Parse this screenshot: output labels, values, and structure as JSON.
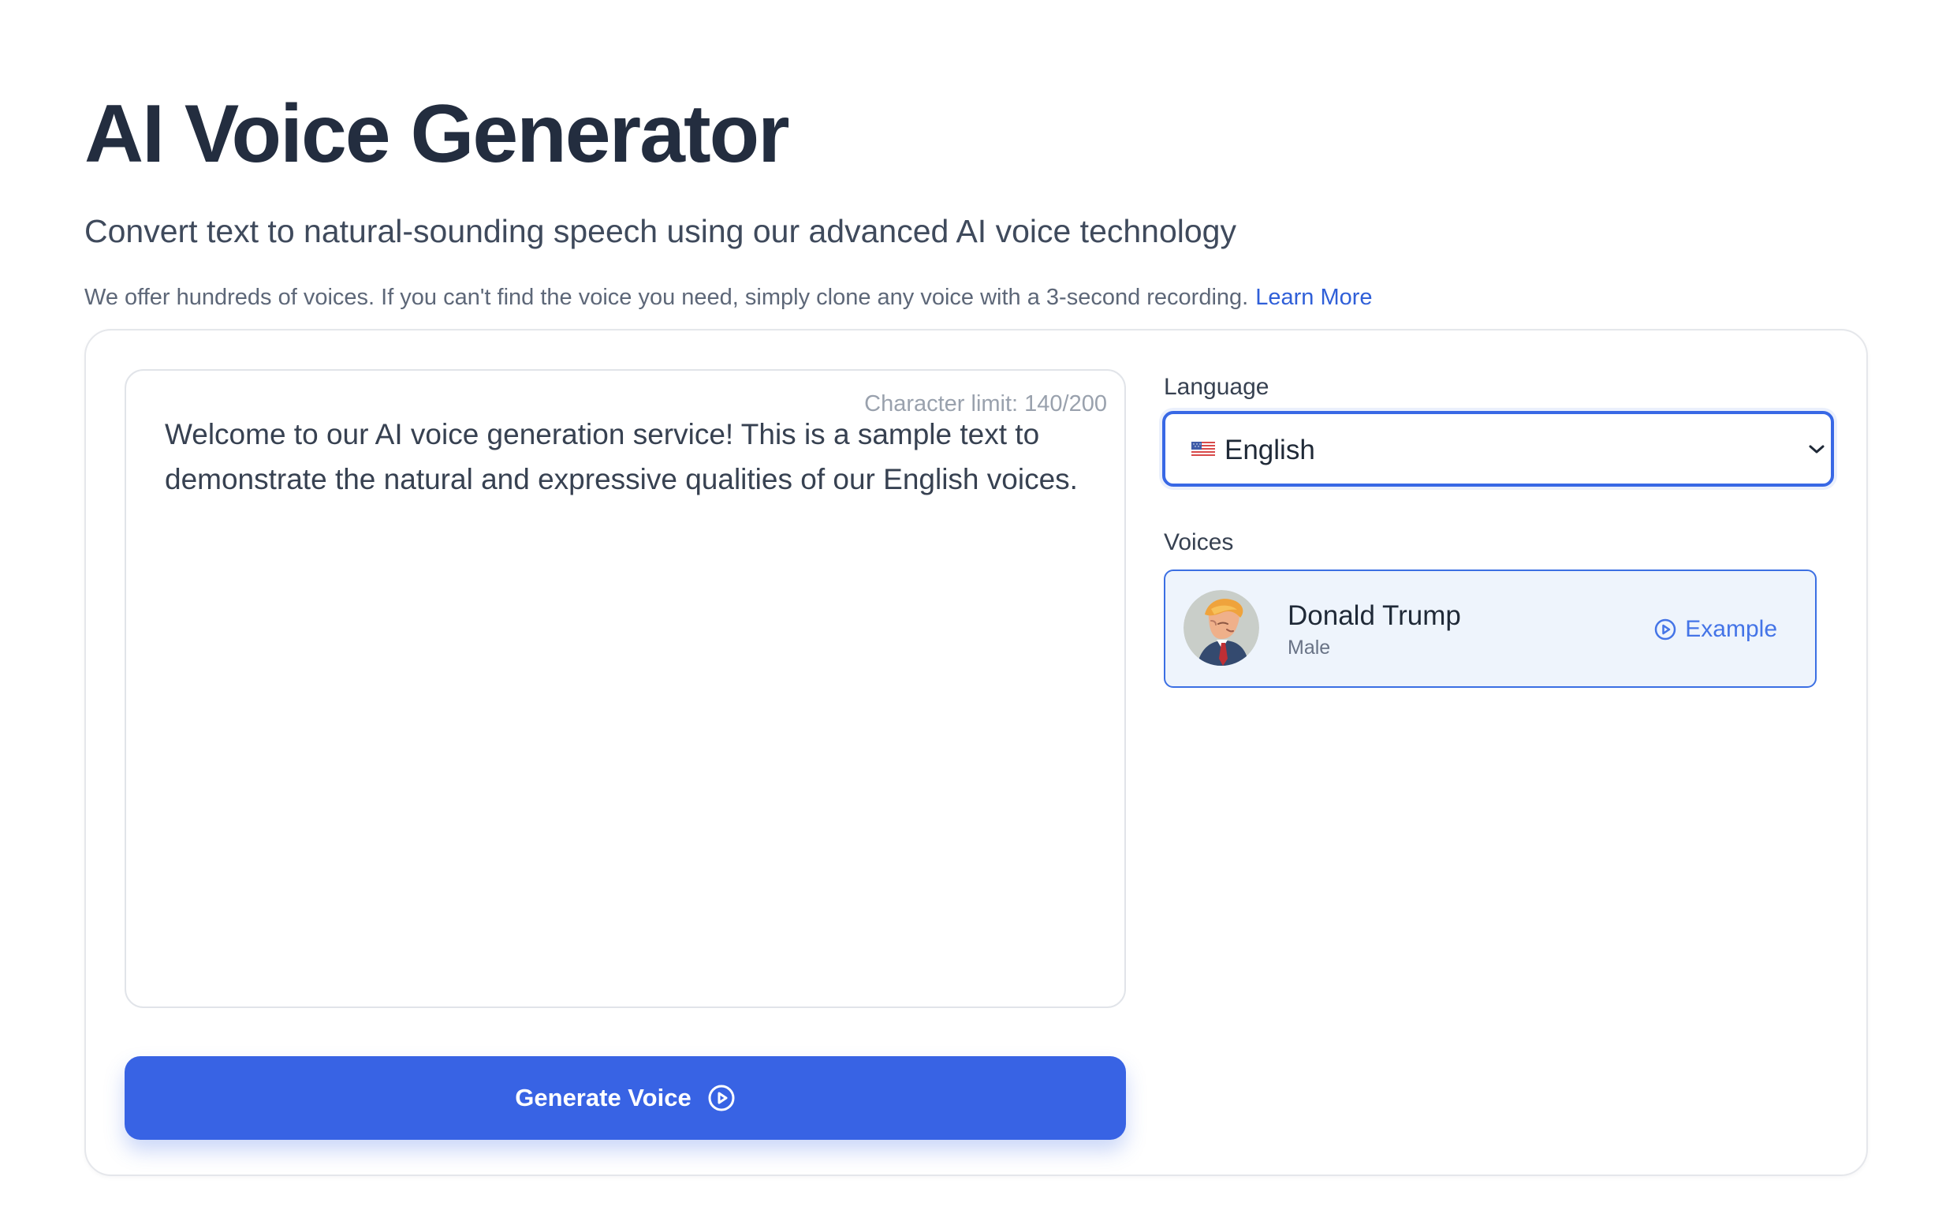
{
  "page": {
    "title": "AI Voice Generator",
    "subtitle": "Convert text to natural-sounding speech using our advanced AI voice technology",
    "info_text": "We offer hundreds of voices. If you can't find the voice you need, simply clone any voice with a 3-second recording.",
    "learn_more_label": "Learn More"
  },
  "editor": {
    "character_limit_label": "Character limit: 140/200",
    "text_value": "Welcome to our AI voice generation service! This is a sample text to demonstrate the natural and expressive qualities of our English voices.",
    "generate_label": "Generate Voice",
    "generate_icon": "play-circle-icon"
  },
  "settings": {
    "language_label": "Language",
    "selected_language": "English",
    "selected_language_flag": "us-flag-icon",
    "voices_label": "Voices"
  },
  "voices": [
    {
      "name": "Donald Trump",
      "gender": "Male",
      "example_label": "Example",
      "avatar_icon": "portrait-avatar",
      "example_icon": "play-circle-icon"
    }
  ],
  "colors": {
    "primary": "#3863e4",
    "link": "#2f5fd8",
    "selected_voice_background": "#eef4fc",
    "selected_voice_border": "#3b6fe3",
    "title": "#232d3f",
    "muted": "#99a1ad"
  }
}
